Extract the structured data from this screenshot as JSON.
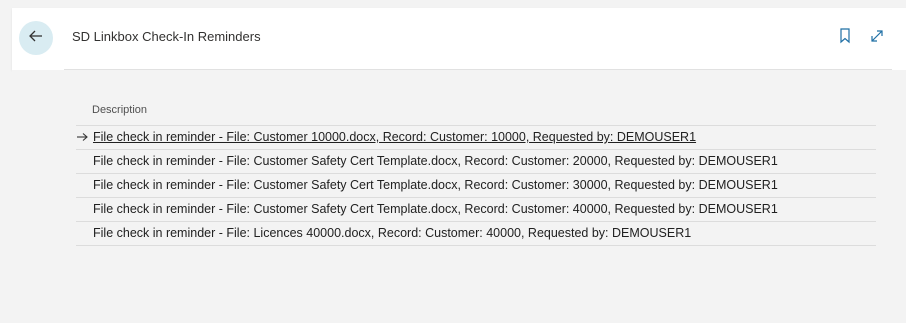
{
  "header": {
    "title": "SD Linkbox Check-In Reminders",
    "back_icon": "arrow-left-icon",
    "bookmark_icon": "bookmark-icon",
    "expand_icon": "expand-icon"
  },
  "list": {
    "column_header": "Description",
    "selected_index": 0,
    "rows": [
      {
        "description": "File check in reminder - File: Customer 10000.docx, Record: Customer: 10000, Requested by: DEMOUSER1"
      },
      {
        "description": "File check in reminder - File: Customer Safety Cert Template.docx, Record: Customer: 20000, Requested by: DEMOUSER1"
      },
      {
        "description": "File check in reminder - File: Customer Safety Cert Template.docx, Record: Customer: 30000, Requested by: DEMOUSER1"
      },
      {
        "description": "File check in reminder - File: Customer Safety Cert Template.docx, Record: Customer: 40000, Requested by: DEMOUSER1"
      },
      {
        "description": "File check in reminder - File: Licences 40000.docx, Record: Customer: 40000, Requested by: DEMOUSER1"
      }
    ]
  },
  "colors": {
    "accent_circle": "#d9ecf2",
    "icon": "#1f6fa5",
    "background": "#f3f3f3"
  }
}
